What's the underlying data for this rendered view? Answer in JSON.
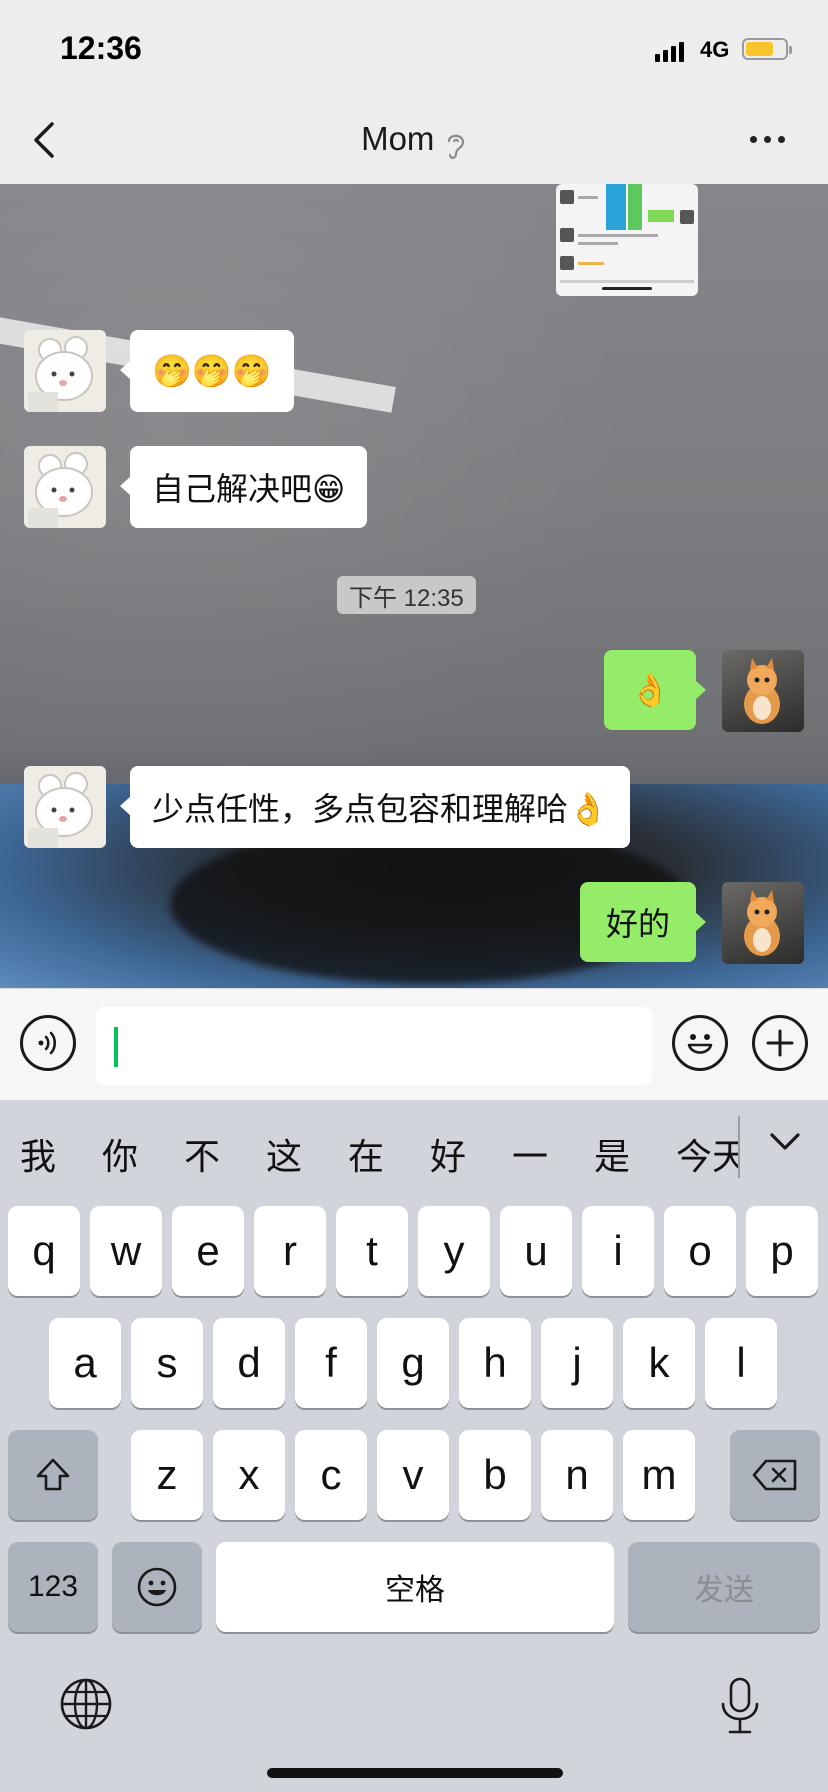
{
  "status_bar": {
    "time": "12:36",
    "network": "4G",
    "battery_level": 0.7
  },
  "header": {
    "title": "Mom"
  },
  "timestamp": "下午 12:35",
  "messages": [
    {
      "side": "left",
      "text": "🤭🤭🤭"
    },
    {
      "side": "left",
      "text": "自己解决吧😁"
    },
    {
      "side": "right",
      "text": "👌"
    },
    {
      "side": "left",
      "text": "少点任性，多点包容和理解哈👌"
    },
    {
      "side": "right",
      "text": "好的"
    }
  ],
  "input": {
    "value": ""
  },
  "candidates": [
    "我",
    "你",
    "不",
    "这",
    "在",
    "好",
    "一",
    "是",
    "今天"
  ],
  "keyboard": {
    "row1": [
      "q",
      "w",
      "e",
      "r",
      "t",
      "y",
      "u",
      "i",
      "o",
      "p"
    ],
    "row2": [
      "a",
      "s",
      "d",
      "f",
      "g",
      "h",
      "j",
      "k",
      "l"
    ],
    "row3": [
      "z",
      "x",
      "c",
      "v",
      "b",
      "n",
      "m"
    ],
    "numbers_label": "123",
    "space_label": "空格",
    "send_label": "发送"
  },
  "colors": {
    "sent_bubble": "#95ec69",
    "received_bubble": "#ffffff",
    "caret": "#07c160"
  }
}
